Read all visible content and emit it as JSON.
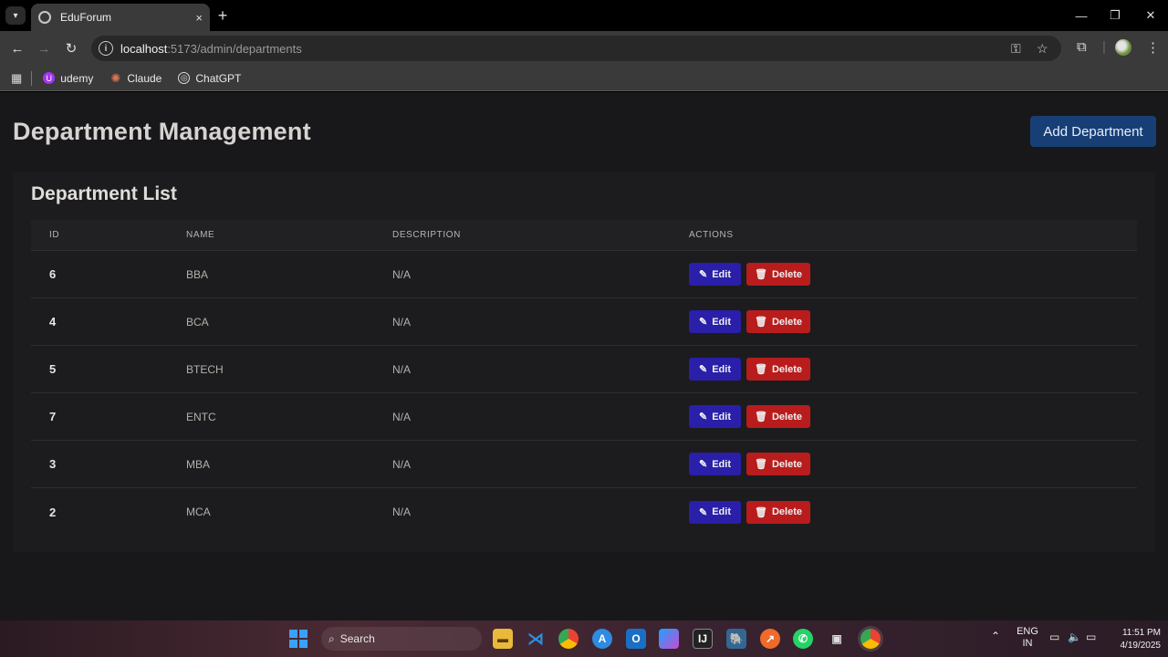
{
  "browser": {
    "tab_title": "EduForum",
    "tab_close": "×",
    "new_tab": "+",
    "url_host": "localhost",
    "url_path": ":5173/admin/departments",
    "bookmarks": [
      {
        "label": "udemy",
        "icon": "udemy-icon",
        "color": "#a435f0"
      },
      {
        "label": "Claude",
        "icon": "claude-icon",
        "color": "#d97757"
      },
      {
        "label": "ChatGPT",
        "icon": "chatgpt-icon",
        "color": "#444444"
      }
    ]
  },
  "page": {
    "title": "Department Management",
    "add_button": "Add Department",
    "list_title": "Department List",
    "columns": [
      "ID",
      "NAME",
      "DESCRIPTION",
      "ACTIONS"
    ],
    "edit_label": "Edit",
    "delete_label": "Delete",
    "rows": [
      {
        "id": "6",
        "name": "BBA",
        "description": "N/A"
      },
      {
        "id": "4",
        "name": "BCA",
        "description": "N/A"
      },
      {
        "id": "5",
        "name": "BTECH",
        "description": "N/A"
      },
      {
        "id": "7",
        "name": "ENTC",
        "description": "N/A"
      },
      {
        "id": "3",
        "name": "MBA",
        "description": "N/A"
      },
      {
        "id": "2",
        "name": "MCA",
        "description": "N/A"
      }
    ]
  },
  "taskbar": {
    "search_placeholder": "Search",
    "lang_top": "ENG",
    "lang_bottom": "IN",
    "time": "11:51 PM",
    "date": "4/19/2025"
  },
  "colors": {
    "page_bg": "#18181b",
    "add_button": "#173f75",
    "edit_button": "#2a1fa8",
    "delete_button": "#b91c1c"
  }
}
